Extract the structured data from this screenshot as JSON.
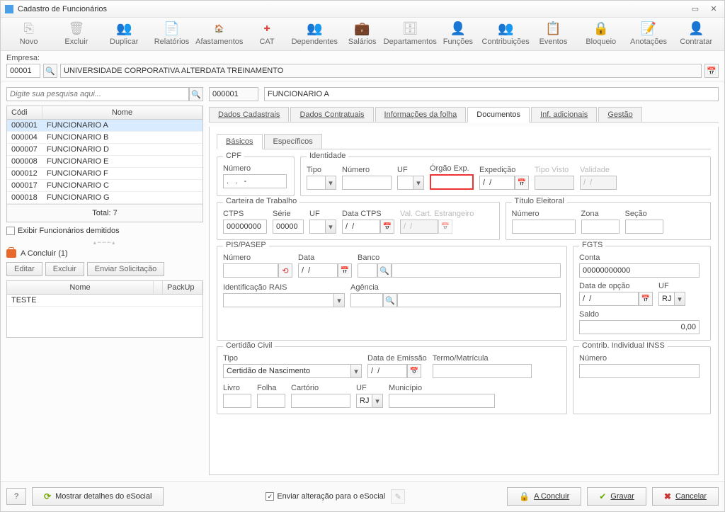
{
  "window": {
    "title": "Cadastro de Funcionários"
  },
  "toolbar": {
    "novo": "Novo",
    "excluir": "Excluir",
    "duplicar": "Duplicar",
    "relatorios": "Relatórios",
    "afastamentos": "Afastamentos",
    "cat": "CAT",
    "dependentes": "Dependentes",
    "salarios": "Salários",
    "departamentos": "Departamentos",
    "funcoes": "Funções",
    "contribuicoes": "Contribuições",
    "eventos": "Eventos",
    "bloqueio": "Bloqueio",
    "anotacoes": "Anotações",
    "contratar": "Contratar"
  },
  "empresa": {
    "label": "Empresa:",
    "code": "00001",
    "name": "UNIVERSIDADE CORPORATIVA ALTERDATA TREINAMENTO"
  },
  "search": {
    "placeholder": "Digite sua pesquisa aqui..."
  },
  "list": {
    "headers": {
      "code": "Códi",
      "name": "Nome"
    },
    "rows": [
      {
        "code": "000001",
        "name": "FUNCIONARIO A",
        "selected": true
      },
      {
        "code": "000004",
        "name": "FUNCIONARIO B"
      },
      {
        "code": "000007",
        "name": "FUNCIONARIO D"
      },
      {
        "code": "000008",
        "name": "FUNCIONARIO E"
      },
      {
        "code": "000012",
        "name": "FUNCIONARIO F"
      },
      {
        "code": "000017",
        "name": "FUNCIONARIO C"
      },
      {
        "code": "000018",
        "name": "FUNCIONARIO G"
      }
    ],
    "total": "Total: 7"
  },
  "exibir_demitidos": "Exibir Funcionários demitidos",
  "pending": {
    "label": "A Concluir (1)"
  },
  "left_buttons": {
    "editar": "Editar",
    "excluir": "Excluir",
    "enviar": "Enviar Solicitação"
  },
  "lower_table": {
    "headers": {
      "nome": "Nome",
      "pack": "PackUp"
    },
    "rows": [
      {
        "nome": "TESTE",
        "pack": ""
      }
    ]
  },
  "func_header": {
    "code": "000001",
    "name": "FUNCIONARIO A"
  },
  "tabs": {
    "dados_cadastrais": "Dados Cadastrais",
    "dados_contratuais": "Dados Contratuais",
    "info_folha": "Informações da folha",
    "documentos": "Documentos",
    "inf_adicionais": "Inf. adicionais",
    "gestao": "Gestão"
  },
  "subtabs": {
    "basicos": "Básicos",
    "especificos": "Específicos"
  },
  "cpf": {
    "title": "CPF",
    "numero_lbl": "Número",
    "numero_val": ".   .   -"
  },
  "identidade": {
    "title": "Identidade",
    "tipo_lbl": "Tipo",
    "numero_lbl": "Número",
    "uf_lbl": "UF",
    "orgao_lbl": "Órgão Exp.",
    "expedicao_lbl": "Expedição",
    "expedicao_val": "/  /",
    "tipo_visto_lbl": "Tipo Visto",
    "validade_lbl": "Validade",
    "validade_val": "/  /"
  },
  "ctps": {
    "title": "Carteira de Trabalho",
    "ctps_lbl": "CTPS",
    "ctps_val": "00000000",
    "serie_lbl": "Série",
    "serie_val": "00000",
    "uf_lbl": "UF",
    "data_lbl": "Data CTPS",
    "data_val": "/  /",
    "val_estrangeiro_lbl": "Val. Cart. Estrangeiro",
    "val_estrangeiro_val": "/  /"
  },
  "titulo": {
    "title": "Título Eleitoral",
    "numero_lbl": "Número",
    "zona_lbl": "Zona",
    "secao_lbl": "Seção"
  },
  "pis": {
    "title": "PIS/PASEP",
    "numero_lbl": "Número",
    "data_lbl": "Data",
    "data_val": "/  /",
    "banco_lbl": "Banco",
    "rais_lbl": "Identificação RAIS",
    "agencia_lbl": "Agência"
  },
  "fgts": {
    "title": "FGTS",
    "conta_lbl": "Conta",
    "conta_val": "00000000000",
    "data_opcao_lbl": "Data de opção",
    "data_opcao_val": "/  /",
    "uf_lbl": "UF",
    "uf_val": "RJ",
    "saldo_lbl": "Saldo",
    "saldo_val": "0,00"
  },
  "certidao": {
    "title": "Certidão Civil",
    "tipo_lbl": "Tipo",
    "tipo_val": "Certidão de Nascimento",
    "data_em_lbl": "Data de Emissão",
    "data_em_val": "/  /",
    "termo_lbl": "Termo/Matrícula",
    "livro_lbl": "Livro",
    "folha_lbl": "Folha",
    "cartorio_lbl": "Cartório",
    "uf_lbl": "UF",
    "uf_val": "RJ",
    "municipio_lbl": "Município"
  },
  "inss": {
    "title": "Contrib. Individual INSS",
    "numero_lbl": "Número"
  },
  "footer": {
    "help": "?",
    "detalhes": "Mostrar detalhes do eSocial",
    "enviar_chk": "Enviar alteração para o eSocial",
    "concluir": "A Concluir",
    "gravar": "Gravar",
    "cancelar": "Cancelar"
  }
}
